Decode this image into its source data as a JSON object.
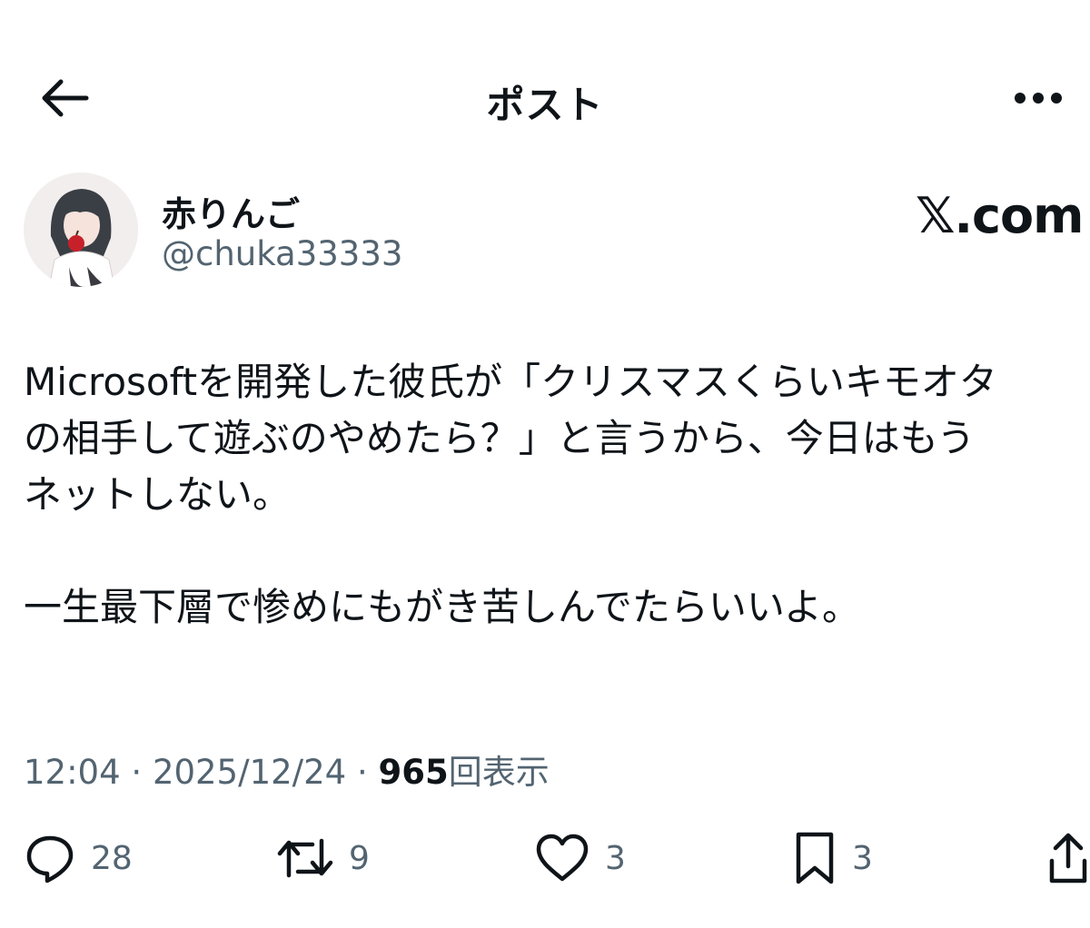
{
  "header": {
    "title": "ポスト",
    "back_icon": "arrow-left-icon",
    "more_icon": "more-horizontal-icon"
  },
  "author": {
    "display_name": "赤りんご",
    "handle": "@chuka33333",
    "avatar": "avatar-image"
  },
  "brand": "𝕏.com",
  "post": {
    "lines": [
      "Microsoftを開発した彼氏が「クリスマスくらいキモオタ",
      "の相手して遊ぶのやめたら？」と言うから、今日はもう",
      "ネットしない。",
      "一生最下層で惨めにもがき苦しんでたらいいよ。"
    ]
  },
  "meta": {
    "time": "12:04",
    "separator": "·",
    "date": "2025/12/24",
    "views_count": "965",
    "views_label": "回表示"
  },
  "actions": {
    "replies": "28",
    "reposts": "9",
    "likes": "3",
    "bookmarks": "3"
  },
  "colors": {
    "text": "#0f1419",
    "secondary": "#536471",
    "background": "#ffffff"
  }
}
